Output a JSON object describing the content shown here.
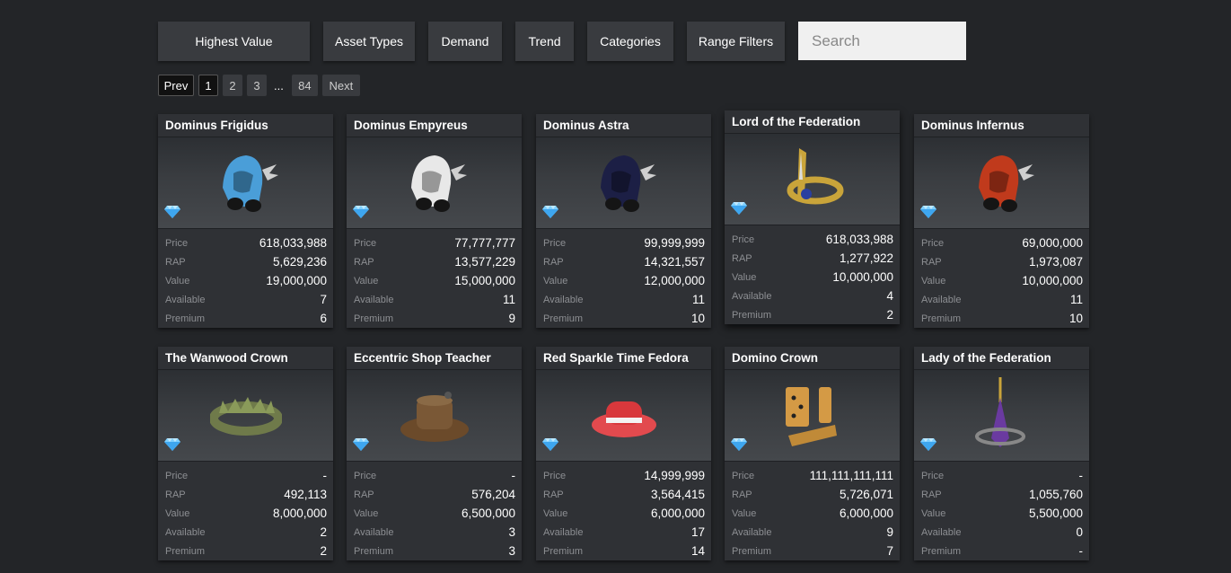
{
  "filters": {
    "highest_value": "Highest Value",
    "asset_types": "Asset Types",
    "demand": "Demand",
    "trend": "Trend",
    "categories": "Categories",
    "range_filters": "Range Filters",
    "search_placeholder": "Search"
  },
  "pagination": {
    "prev": "Prev",
    "pages": [
      "1",
      "2",
      "3"
    ],
    "ellipsis": "...",
    "last": "84",
    "next": "Next"
  },
  "stat_labels": {
    "price": "Price",
    "rap": "RAP",
    "value": "Value",
    "available": "Available",
    "premium": "Premium"
  },
  "items": [
    {
      "name": "Dominus Frigidus",
      "icon": "dominus-frigidus-icon",
      "color": "#4a9ed8",
      "price": "618,033,988",
      "rap": "5,629,236",
      "value": "19,000,000",
      "available": "7",
      "premium": "6"
    },
    {
      "name": "Dominus Empyreus",
      "icon": "dominus-empyreus-icon",
      "color": "#e8e8e8",
      "price": "77,777,777",
      "rap": "13,577,229",
      "value": "15,000,000",
      "available": "11",
      "premium": "9"
    },
    {
      "name": "Dominus Astra",
      "icon": "dominus-astra-icon",
      "color": "#1c1f45",
      "price": "99,999,999",
      "rap": "14,321,557",
      "value": "12,000,000",
      "available": "11",
      "premium": "10"
    },
    {
      "name": "Lord of the Federation",
      "icon": "lord-federation-icon",
      "color": "#c9a43a",
      "price": "618,033,988",
      "rap": "1,277,922",
      "value": "10,000,000",
      "available": "4",
      "premium": "2"
    },
    {
      "name": "Dominus Infernus",
      "icon": "dominus-infernus-icon",
      "color": "#c03a1c",
      "price": "69,000,000",
      "rap": "1,973,087",
      "value": "10,000,000",
      "available": "11",
      "premium": "10"
    },
    {
      "name": "The Wanwood Crown",
      "icon": "wanwood-crown-icon",
      "color": "#6f7a4a",
      "price": "-",
      "rap": "492,113",
      "value": "8,000,000",
      "available": "2",
      "premium": "2"
    },
    {
      "name": "Eccentric Shop Teacher",
      "icon": "eccentric-teacher-hat-icon",
      "color": "#6b4a2a",
      "price": "-",
      "rap": "576,204",
      "value": "6,500,000",
      "available": "3",
      "premium": "3"
    },
    {
      "name": "Red Sparkle Time Fedora",
      "icon": "red-sparkle-fedora-icon",
      "color": "#d8383c",
      "price": "14,999,999",
      "rap": "3,564,415",
      "value": "6,000,000",
      "available": "17",
      "premium": "14"
    },
    {
      "name": "Domino Crown",
      "icon": "domino-crown-icon",
      "color": "#d49a45",
      "price": "111,111,111,111",
      "rap": "5,726,071",
      "value": "6,000,000",
      "available": "9",
      "premium": "7"
    },
    {
      "name": "Lady of the Federation",
      "icon": "lady-federation-icon",
      "color": "#6a3aa0",
      "price": "-",
      "rap": "1,055,760",
      "value": "5,500,000",
      "available": "0",
      "premium": "-"
    }
  ],
  "colors": {
    "background": "#232528",
    "card": "#2f3135",
    "button": "#393b3f",
    "diamond": "#6ec6ff"
  }
}
